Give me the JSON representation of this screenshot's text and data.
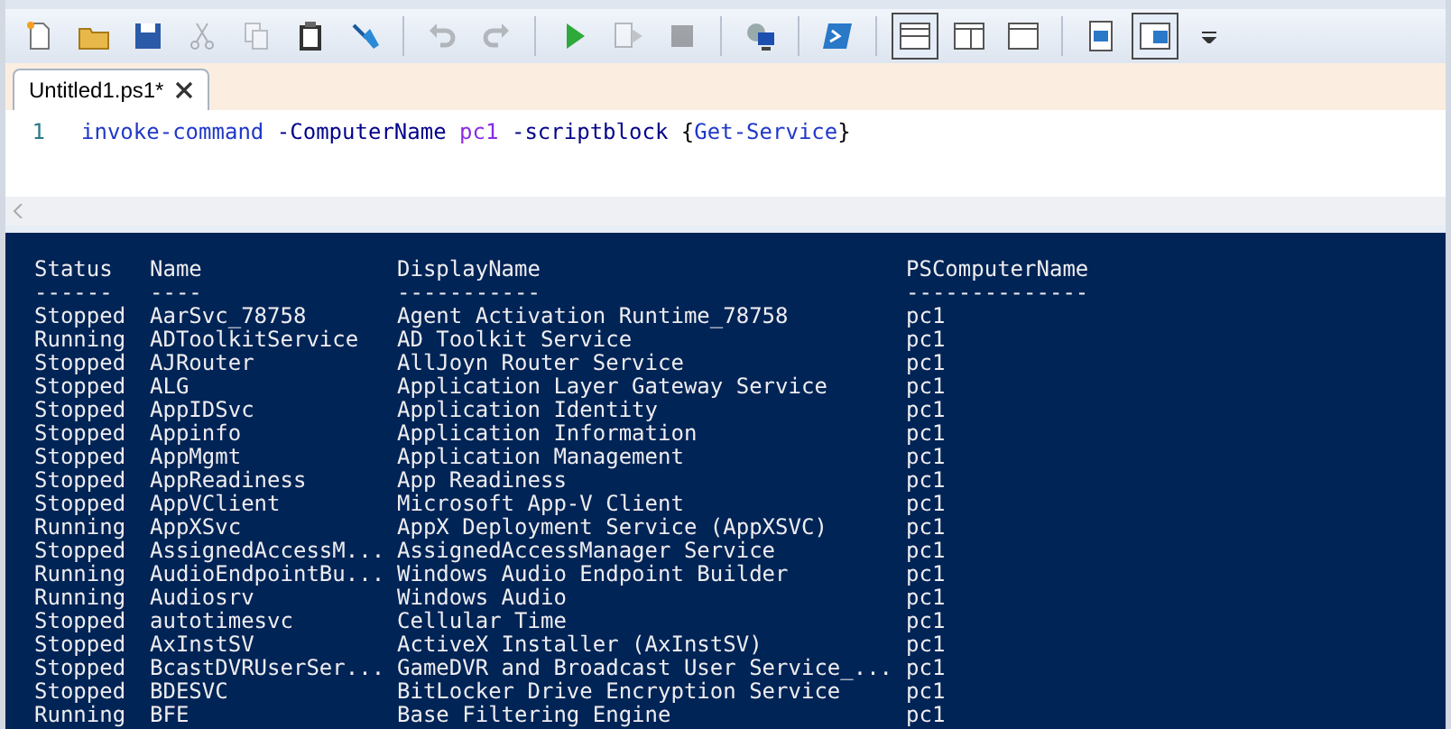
{
  "toolbar": [
    {
      "kind": "new",
      "disabled": false
    },
    {
      "kind": "open",
      "disabled": false
    },
    {
      "kind": "save",
      "disabled": false
    },
    {
      "kind": "cut",
      "disabled": true
    },
    {
      "kind": "copy",
      "disabled": true
    },
    {
      "kind": "paste",
      "disabled": false
    },
    {
      "kind": "clear",
      "disabled": false
    },
    {
      "kind": "sep"
    },
    {
      "kind": "undo",
      "disabled": true
    },
    {
      "kind": "redo",
      "disabled": true
    },
    {
      "kind": "sep"
    },
    {
      "kind": "run",
      "disabled": false
    },
    {
      "kind": "run-selection",
      "disabled": true
    },
    {
      "kind": "stop",
      "disabled": true
    },
    {
      "kind": "sep"
    },
    {
      "kind": "remote",
      "disabled": false
    },
    {
      "kind": "sep"
    },
    {
      "kind": "console",
      "disabled": false
    },
    {
      "kind": "sep"
    },
    {
      "kind": "layout-top",
      "selected": true
    },
    {
      "kind": "layout-right",
      "selected": false
    },
    {
      "kind": "layout-max",
      "selected": false
    },
    {
      "kind": "sep"
    },
    {
      "kind": "show-script",
      "selected": false
    },
    {
      "kind": "show-script-right",
      "selected": true
    },
    {
      "kind": "overflow"
    }
  ],
  "tabs": [
    {
      "label": "Untitled1.ps1*",
      "selected": true
    }
  ],
  "editor": {
    "lines": [
      {
        "number": "1",
        "tokens": [
          {
            "text": "invoke-command",
            "kind": "command"
          },
          {
            "text": "-ComputerName",
            "kind": "parameter"
          },
          {
            "text": "pc1",
            "kind": "argument"
          },
          {
            "text": "-scriptblock",
            "kind": "parameter"
          },
          {
            "text": "{",
            "kind": "brace"
          },
          {
            "text": "Get-Service",
            "kind": "command"
          },
          {
            "text": "}",
            "kind": "brace"
          }
        ]
      }
    ]
  },
  "console": {
    "columns": [
      {
        "header": "Status",
        "underline": "------"
      },
      {
        "header": "Name",
        "underline": "----"
      },
      {
        "header": "DisplayName",
        "underline": "-----------"
      },
      {
        "header": "PSComputerName",
        "underline": "--------------"
      }
    ],
    "rows": [
      [
        "Stopped",
        "AarSvc_78758",
        "Agent Activation Runtime_78758",
        "pc1"
      ],
      [
        "Running",
        "ADToolkitService",
        "AD Toolkit Service",
        "pc1"
      ],
      [
        "Stopped",
        "AJRouter",
        "AllJoyn Router Service",
        "pc1"
      ],
      [
        "Stopped",
        "ALG",
        "Application Layer Gateway Service",
        "pc1"
      ],
      [
        "Stopped",
        "AppIDSvc",
        "Application Identity",
        "pc1"
      ],
      [
        "Stopped",
        "Appinfo",
        "Application Information",
        "pc1"
      ],
      [
        "Stopped",
        "AppMgmt",
        "Application Management",
        "pc1"
      ],
      [
        "Stopped",
        "AppReadiness",
        "App Readiness",
        "pc1"
      ],
      [
        "Stopped",
        "AppVClient",
        "Microsoft App-V Client",
        "pc1"
      ],
      [
        "Running",
        "AppXSvc",
        "AppX Deployment Service (AppXSVC)",
        "pc1"
      ],
      [
        "Stopped",
        "AssignedAccessM...",
        "AssignedAccessManager Service",
        "pc1"
      ],
      [
        "Running",
        "AudioEndpointBu...",
        "Windows Audio Endpoint Builder",
        "pc1"
      ],
      [
        "Running",
        "Audiosrv",
        "Windows Audio",
        "pc1"
      ],
      [
        "Stopped",
        "autotimesvc",
        "Cellular Time",
        "pc1"
      ],
      [
        "Stopped",
        "AxInstSV",
        "ActiveX Installer (AxInstSV)",
        "pc1"
      ],
      [
        "Stopped",
        "BcastDVRUserSer...",
        "GameDVR and Broadcast User Service_...",
        "pc1"
      ],
      [
        "Stopped",
        "BDESVC",
        "BitLocker Drive Encryption Service",
        "pc1"
      ],
      [
        "Running",
        "BFE",
        "Base Filtering Engine",
        "pc1"
      ]
    ]
  }
}
